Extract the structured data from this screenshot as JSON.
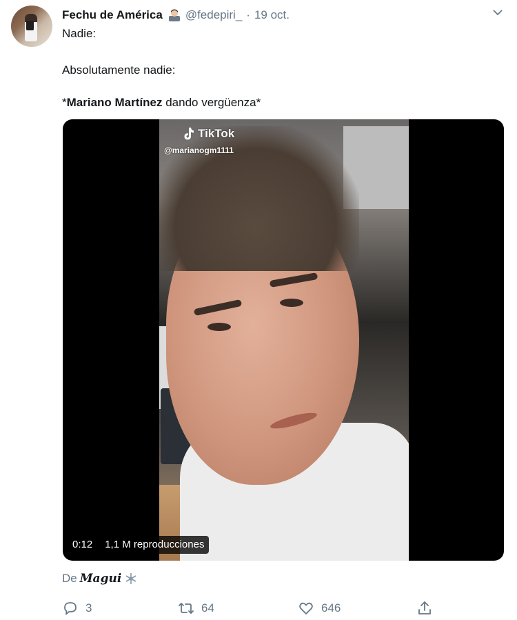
{
  "tweet": {
    "display_name": "Fechu de América",
    "handle": "@fedepiri_",
    "separator": "·",
    "date": "19 oct.",
    "text_line1": "Nadie:",
    "text_line2": "Absolutamente nadie:",
    "text_line3_pre": "*",
    "text_line3_bold": "Mariano Martínez",
    "text_line3_post": " dando vergüenza*",
    "source_prefix": "De",
    "source_brand": "Magui"
  },
  "video": {
    "watermark_brand": "TikTok",
    "watermark_user": "@marianogm1111",
    "duration": "0:12",
    "views": "1,1 M reproducciones"
  },
  "actions": {
    "reply_count": "3",
    "retweet_count": "64",
    "like_count": "646"
  },
  "colors": {
    "secondary_text": "#657786",
    "primary_text": "#14171a",
    "video_bg": "#000000"
  },
  "icons": [
    "verified-emoji-icon",
    "chevron-down-icon",
    "tiktok-logo-icon",
    "snowflake-icon",
    "reply-icon",
    "retweet-icon",
    "like-icon",
    "share-icon"
  ]
}
